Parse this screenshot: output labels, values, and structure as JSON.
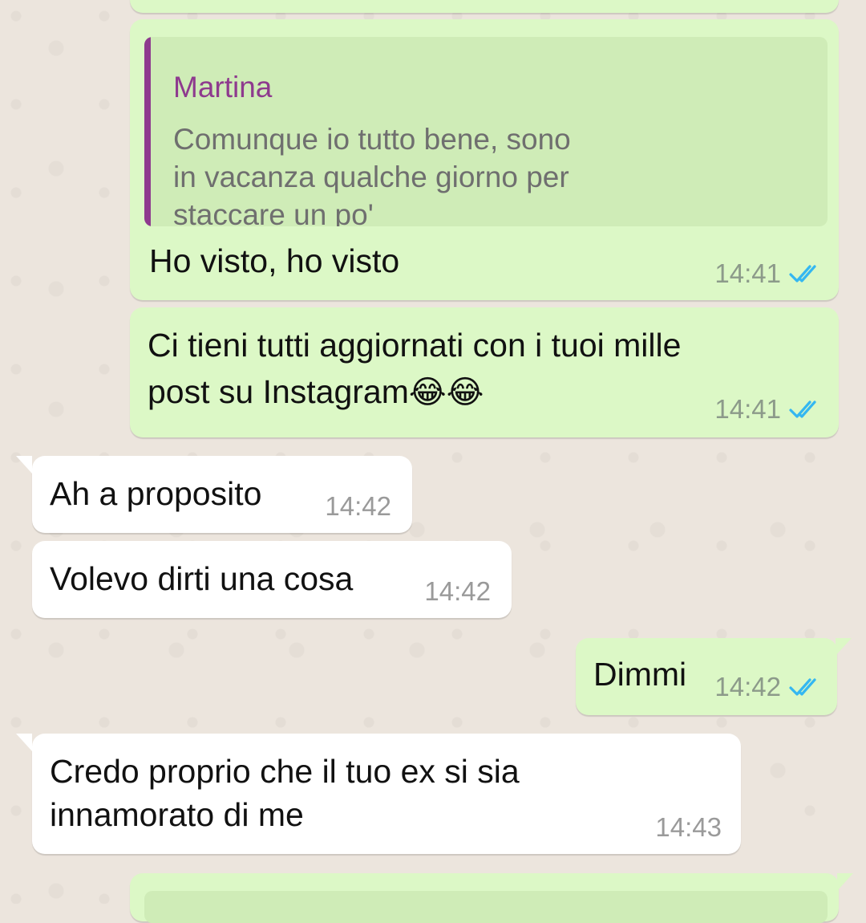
{
  "chat": {
    "messages": [
      {
        "id": "m1",
        "direction": "outgoing",
        "reply": {
          "author": "Martina",
          "text": "Comunque io tutto bene, sono\nin vacanza qualche giorno per\nstaccare un po'"
        },
        "text": "Ho visto, ho visto",
        "time": "14:41",
        "status": "read-double-tick"
      },
      {
        "id": "m2",
        "direction": "outgoing",
        "lines": [
          "Ci tieni tutti aggiornati con i tuoi mille",
          "post su Instagram"
        ],
        "emoji": "😂😂",
        "time": "14:41",
        "status": "read-double-tick"
      },
      {
        "id": "m3",
        "direction": "incoming",
        "text": "Ah a proposito",
        "time": "14:42"
      },
      {
        "id": "m4",
        "direction": "incoming",
        "text": "Volevo dirti una cosa",
        "time": "14:42"
      },
      {
        "id": "m5",
        "direction": "outgoing",
        "text": "Dimmi",
        "time": "14:42",
        "status": "read-double-tick"
      },
      {
        "id": "m6",
        "direction": "incoming",
        "lines": [
          "Credo proprio che il tuo ex si sia",
          "innamorato di me"
        ],
        "time": "14:43"
      }
    ]
  },
  "colors": {
    "outgoing_bubble": "#dcf8c6",
    "incoming_bubble": "#ffffff",
    "quote_accent": "#8e3a8e",
    "read_tick": "#34b7f1",
    "background": "#ece5dd"
  },
  "icons": {
    "read_status": "double-check-icon"
  }
}
